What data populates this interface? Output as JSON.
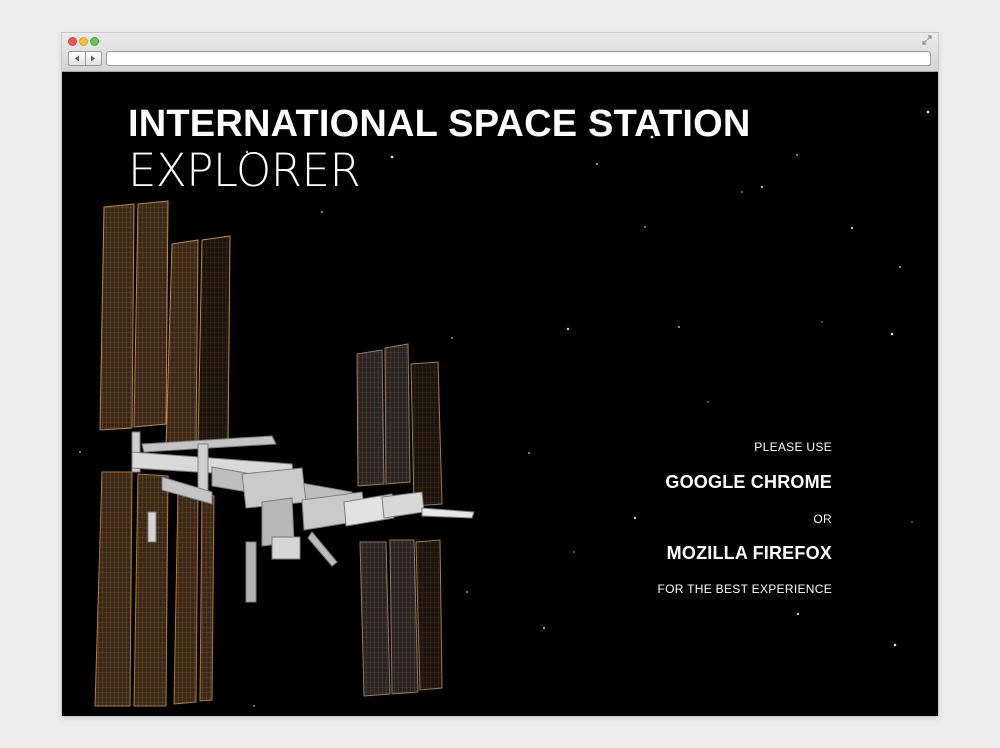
{
  "window": {
    "controls": [
      "close-button",
      "minimize-button",
      "maximize-button"
    ],
    "nav": {
      "back_icon": "left-triangle-icon",
      "forward_icon": "right-triangle-icon"
    },
    "address_bar": {
      "value": ""
    },
    "expand_icon": "expand-arrows-icon"
  },
  "page": {
    "title_line1": "INTERNATIONAL SPACE STATION",
    "title_line2": "EXPLORER",
    "notice": {
      "please_use": "PLEASE USE",
      "browser1": "GOOGLE CHROME",
      "or": "OR",
      "browser2": "MOZILLA FIREFOX",
      "footer": "FOR THE BEST EXPERIENCE"
    },
    "background_color": "#000000",
    "text_color": "#ffffff"
  }
}
